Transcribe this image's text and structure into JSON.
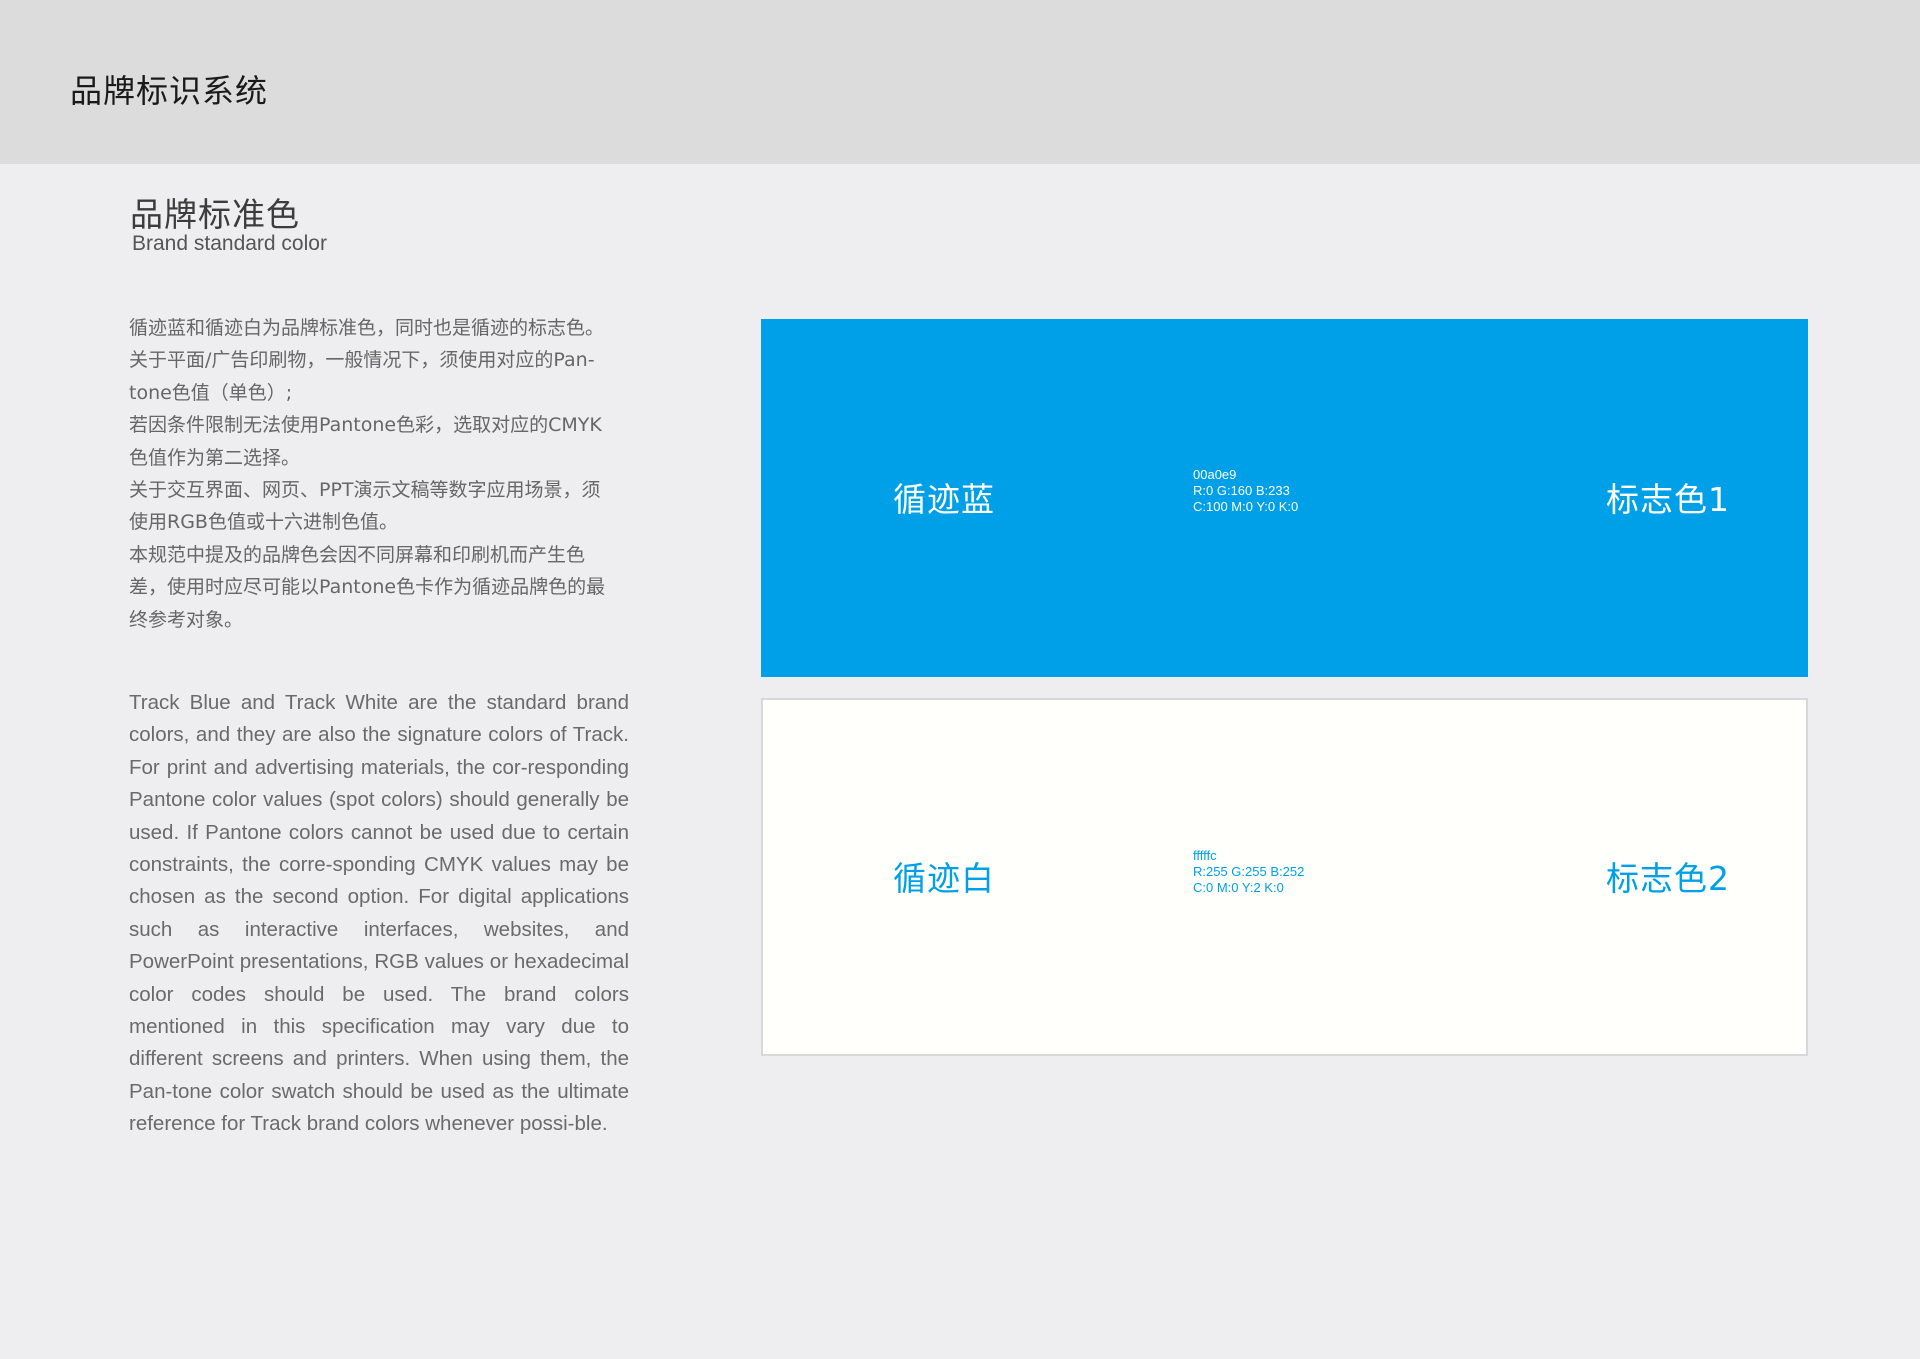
{
  "header": {
    "title": "品牌标识系统"
  },
  "section": {
    "title": "品牌标准色",
    "subtitle": "Brand standard color"
  },
  "body_cn": [
    "循迹蓝和循迹白为品牌标准色，同时也是循迹的标志色。",
    "关于平面/广告印刷物，一般情况下，须使用对应的Pan-",
    "tone色值（单色）;",
    "若因条件限制无法使用Pantone色彩，选取对应的CMYK",
    "色值作为第二选择。",
    "关于交互界面、网页、PPT演示文稿等数字应用场景，须",
    "使用RGB色值或十六进制色值。",
    "本规范中提及的品牌色会因不同屏幕和印刷机而产生色",
    "差，使用时应尽可能以Pantone色卡作为循迹品牌色的最",
    "终参考对象。"
  ],
  "body_en": "Track Blue and Track White are the standard brand colors, and they are also the signature colors of Track. For print and advertising materials, the cor-responding Pantone color values (spot colors) should generally be used. If Pantone colors cannot be used due to certain constraints, the corre-sponding CMYK values may be chosen as the second option. For digital applications such as interactive interfaces, websites, and PowerPoint presentations, RGB values or hexadecimal color codes should be used. The brand colors mentioned in this specification may vary due to different screens and printers. When using them, the Pan-tone color swatch should be used as the ultimate reference for Track brand colors whenever possi-ble.",
  "swatches": [
    {
      "name": "循迹蓝",
      "hex": "00a0e9",
      "rgb": "R:0 G:160 B:233",
      "cmyk": "C:100 M:0 Y:0 K:0",
      "label": "标志色1",
      "color": "#00a0e9",
      "text_color": "#ffffff"
    },
    {
      "name": "循迹白",
      "hex": "fffffc",
      "rgb": "R:255 G:255 B:252",
      "cmyk": "C:0 M:0 Y:2 K:0",
      "label": "标志色2",
      "color": "#fffffc",
      "text_color": "#00a0e9"
    }
  ]
}
